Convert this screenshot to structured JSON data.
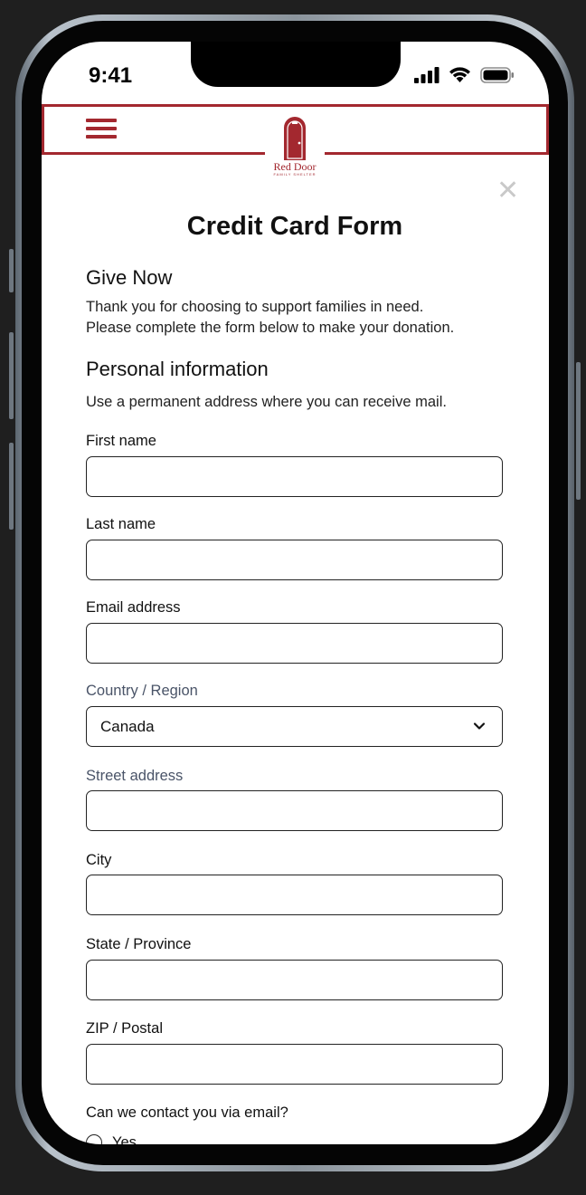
{
  "status_bar": {
    "time": "9:41"
  },
  "header": {
    "logo_name": "Red Door",
    "logo_tagline": "FAMILY SHELTER",
    "brand_color": "#a3282f"
  },
  "form": {
    "title": "Credit Card Form",
    "section_give": {
      "heading": "Give Now",
      "line1": "Thank you for choosing to support families in need.",
      "line2": "Please complete the form below to make your donation."
    },
    "section_personal": {
      "heading": "Personal information",
      "description": "Use a permanent address where you can receive mail."
    },
    "fields": {
      "first_name": {
        "label": "First name",
        "value": ""
      },
      "last_name": {
        "label": "Last name",
        "value": ""
      },
      "email": {
        "label": "Email address",
        "value": ""
      },
      "country": {
        "label": "Country / Region",
        "value": "Canada"
      },
      "street": {
        "label": "Street address",
        "value": ""
      },
      "city": {
        "label": "City",
        "value": ""
      },
      "state": {
        "label": "State / Province",
        "value": ""
      },
      "zip": {
        "label": "ZIP / Postal",
        "value": ""
      }
    },
    "contact_question": "Can we contact you via email?",
    "contact_options": [
      "Yes"
    ]
  },
  "icons": {
    "menu": "hamburger-menu-icon",
    "close": "close-icon",
    "dropdown": "chevron-down-icon",
    "signal": "cellular-signal-icon",
    "wifi": "wifi-icon",
    "battery": "battery-icon"
  }
}
